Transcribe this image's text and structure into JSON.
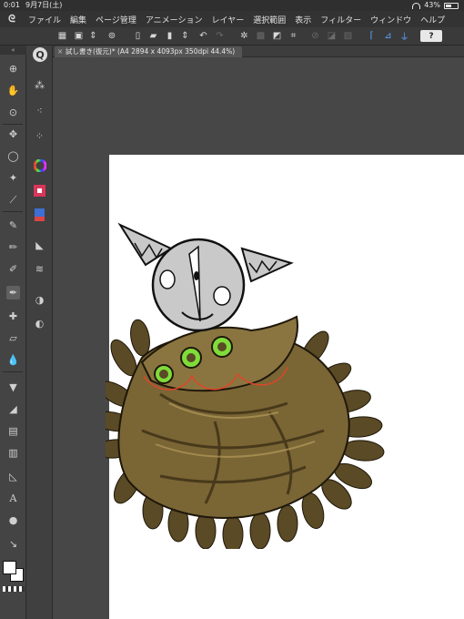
{
  "status": {
    "time": "0:01",
    "date": "9月7日(土)",
    "battery": "43%"
  },
  "menu": {
    "items": [
      "ファイル",
      "編集",
      "ページ管理",
      "アニメーション",
      "レイヤー",
      "選択範囲",
      "表示",
      "フィルター",
      "ウィンドウ",
      "ヘルプ"
    ]
  },
  "toolbar": {
    "help_label": "?"
  },
  "panel": {
    "collapse_label": "«"
  },
  "document": {
    "tab_title": "試し書き(復元)* (A4 2894 x 4093px 350dpi 44.4%)",
    "close_glyph": "×"
  },
  "colors": {
    "app_bg": "#4b4b4b",
    "canvas": "#ffffff",
    "accent": "#5aa2ff",
    "cloak": "#7a6535",
    "eye_green": "#7fdc3a",
    "sketch_red": "#e0452a"
  }
}
